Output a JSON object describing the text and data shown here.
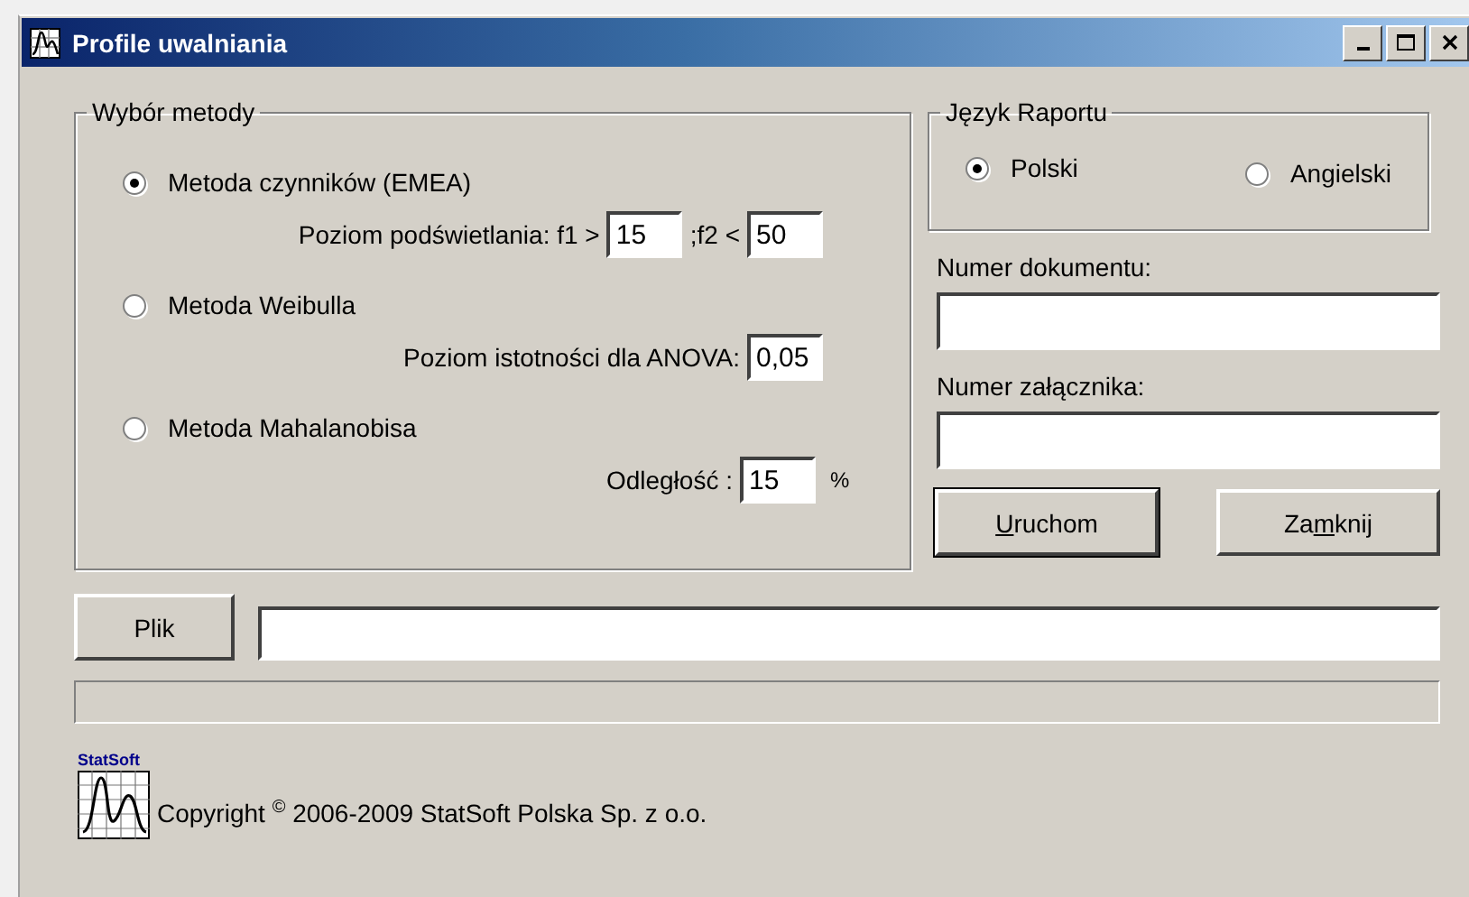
{
  "window": {
    "title": "Profile uwalniania"
  },
  "method_group": {
    "title": "Wybór metody",
    "methods": [
      {
        "label": "Metoda czynników  (EMEA)",
        "selected": true,
        "params": [
          {
            "label": "Poziom podświetlania:  f1 >",
            "value": "15"
          },
          {
            "label": ";f2 <",
            "value": "50"
          }
        ]
      },
      {
        "label": "Metoda Weibulla",
        "selected": false,
        "params": [
          {
            "label": "Poziom istotności dla ANOVA:",
            "value": "0,05"
          }
        ]
      },
      {
        "label": "Metoda Mahalanobisa",
        "selected": false,
        "params": [
          {
            "label": "Odległość :",
            "value": "15",
            "unit": "%"
          }
        ]
      }
    ]
  },
  "language_group": {
    "title": "Język Raportu",
    "options": [
      {
        "label": "Polski",
        "selected": true
      },
      {
        "label": "Angielski",
        "selected": false
      }
    ]
  },
  "document_number": {
    "label": "Numer dokumentu:"
  },
  "attachment_number": {
    "label": "Numer załącznika:"
  },
  "buttons": [
    {
      "label_parts": [
        {
          "text": "U",
          "underlined": true
        },
        {
          "text": "ruchom",
          "underlined": false
        }
      ],
      "default": true
    },
    {
      "label_parts": [
        {
          "text": "Za",
          "underlined": false
        },
        {
          "text": "m",
          "underlined": true
        },
        {
          "text": "knij",
          "underlined": false
        }
      ],
      "default": false
    }
  ],
  "file": {
    "button": "Plik"
  },
  "progress": {
    "level": 0
  },
  "footer": {
    "logo_label": "StatSoft",
    "copyright": "Copyright $^{©}$ 2006-2009 StatSoft Polska Sp. z o.o."
  }
}
